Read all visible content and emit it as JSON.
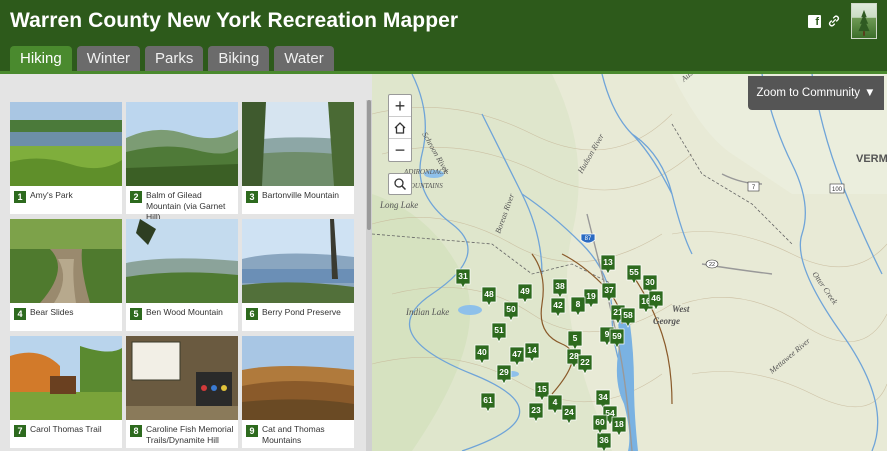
{
  "header": {
    "title": "Warren County New York Recreation Mapper"
  },
  "share": {
    "facebook_icon": "facebook-icon",
    "link_icon": "link-icon"
  },
  "tabs": [
    {
      "label": "Hiking",
      "active": true
    },
    {
      "label": "Winter",
      "active": false
    },
    {
      "label": "Parks",
      "active": false
    },
    {
      "label": "Biking",
      "active": false
    },
    {
      "label": "Water",
      "active": false
    }
  ],
  "sidebar": {
    "trails": [
      {
        "num": "1",
        "name": "Amy's Park"
      },
      {
        "num": "2",
        "name": "Balm of Gilead Mountain (via Garnet Hill)"
      },
      {
        "num": "3",
        "name": "Bartonville Mountain"
      },
      {
        "num": "4",
        "name": "Bear Slides"
      },
      {
        "num": "5",
        "name": "Ben Wood Mountain"
      },
      {
        "num": "6",
        "name": "Berry Pond Preserve"
      },
      {
        "num": "7",
        "name": "Carol Thomas Trail"
      },
      {
        "num": "8",
        "name": "Caroline Fish Memorial Trails/Dynamite Hill"
      },
      {
        "num": "9",
        "name": "Cat and Thomas Mountains"
      }
    ]
  },
  "map": {
    "zoom_in": "+",
    "zoom_out": "−",
    "zoom_to_community": "Zoom to Community",
    "dropdown_glyph": "▼",
    "labels": {
      "adirondack": "ADIRONDACK",
      "mountains": "MOUNTAINS",
      "long_lake": "Long Lake",
      "indian_lake": "Indian Lake",
      "schroon_river": "Schroon River",
      "boreas_river": "Boreas River",
      "hudson_river": "Hudson River",
      "ausable_river": "Ausable River",
      "otter_creek": "Otter Creek",
      "mettawee_river": "Mettawee River",
      "west": "West",
      "george": "George",
      "verm": "VERM",
      "i87": "87",
      "rt22": "22",
      "rt7": "7",
      "rt100": "100"
    },
    "markers": [
      "13",
      "55",
      "31",
      "48",
      "49",
      "38",
      "19",
      "37",
      "8",
      "30",
      "16",
      "50",
      "42",
      "21",
      "58",
      "51",
      "5",
      "9",
      "59",
      "40",
      "47",
      "14",
      "28",
      "22",
      "29",
      "15",
      "4",
      "61",
      "34",
      "23",
      "24",
      "54",
      "18",
      "36",
      "60",
      "46"
    ]
  },
  "colors": {
    "header_bg": "#2d5a1b",
    "tab_active": "#4a8a2e",
    "tab_inactive": "#6b6b6b",
    "marker": "#2d6a1e",
    "community_button": "#555555"
  }
}
